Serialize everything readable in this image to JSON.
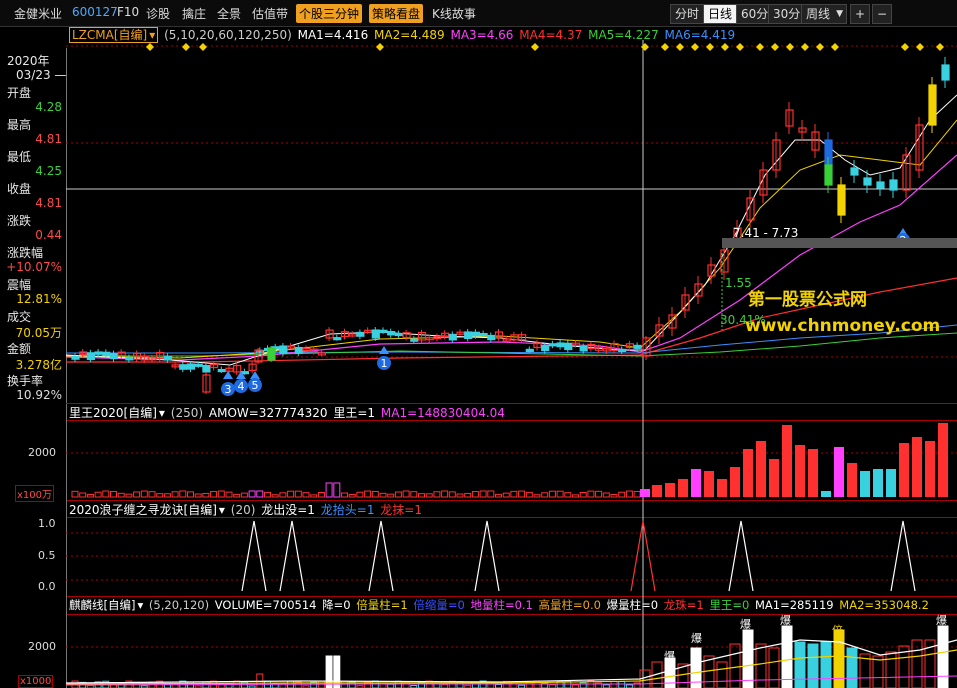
{
  "toolbar": {
    "stock_name": "金健米业",
    "stock_code": "600127",
    "f10": "F10",
    "diagnose": "诊股",
    "pick_top": "擒庄",
    "panorama": "全景",
    "valuation": "估值带",
    "three_min": "个股三分钟",
    "strategy": "策略看盘",
    "k_story": "K线故事",
    "period_minute": "分时",
    "period_day": "日线",
    "period_60": "60分",
    "period_30": "30分",
    "period_week": "周线",
    "zoom_in": "+",
    "zoom_out": "−"
  },
  "info": {
    "year": "2020年",
    "date": "03/23 —",
    "open_label": "开盘",
    "open": "4.28",
    "high_label": "最高",
    "high": "4.81",
    "low_label": "最低",
    "low": "4.25",
    "close_label": "收盘",
    "close": "4.81",
    "chg_label": "涨跌",
    "chg": "0.44",
    "chgpct_label": "涨跌幅",
    "chgpct": "+10.07%",
    "amp_label": "震幅",
    "amp": "12.81%",
    "vol_label": "成交",
    "vol": "70.05万",
    "amt_label": "金额",
    "amt": "3.278亿",
    "turn_label": "换手率",
    "turn": "10.92%"
  },
  "main": {
    "indicator": "LZCMA[自编]",
    "params": "(5,10,20,60,120,250)",
    "ma1": "MA1=4.416",
    "ma2": "MA2=4.489",
    "ma3": "MA3=4.66",
    "ma4": "MA4=4.37",
    "ma5": "MA5=4.227",
    "ma6": "MA6=4.419",
    "range_label": "7.41 - 7.73",
    "pct_a": "1.55",
    "pct_b": "30.41%",
    "markers": [
      "1",
      "2",
      "3",
      "4",
      "5"
    ],
    "wm_cn": "第一股票公式网",
    "wm_url": "www.chnmoney.com",
    "colors": {
      "ma1": "#ffffff",
      "ma2": "#f2d200",
      "ma3": "#ff40ff",
      "ma4": "#ff3030",
      "ma5": "#39d039",
      "ma6": "#3a90ff"
    }
  },
  "panel2": {
    "title": "里王2020[自编]",
    "param": "(250)",
    "amow": "AMOW=327774320",
    "liwang": "里王=1",
    "ma1": "MA1=148830404.04",
    "y_2000": "2000",
    "unit": "x100万"
  },
  "panel3": {
    "title": "2020浪子缠之寻龙诀[自编]",
    "param": "(20)",
    "a": "龙出没=1",
    "b": "龙抬头=1",
    "c": "龙抹=1",
    "y_top": "1.0",
    "y_mid": "0.5",
    "y_bot": "0.0"
  },
  "panel4": {
    "title": "麒麟线[自编]",
    "param": "(5,20,120)",
    "volume": "VOLUME=700514",
    "jiang": "降=0",
    "beiliang": "倍量柱=1",
    "dimliang": "倍缩量=0",
    "diliang": "地量柱=0.1",
    "gaoliang": "高量柱=0.0",
    "baoliang": "爆量柱=0",
    "longzhu": "龙珠=1",
    "liwang": "里王=0",
    "ma1": "MA1=285119",
    "ma2": "MA2=353048.2",
    "y_2000": "2000",
    "unit": "x1000",
    "tag_bao": "爆",
    "tag_bei": "倍"
  }
}
